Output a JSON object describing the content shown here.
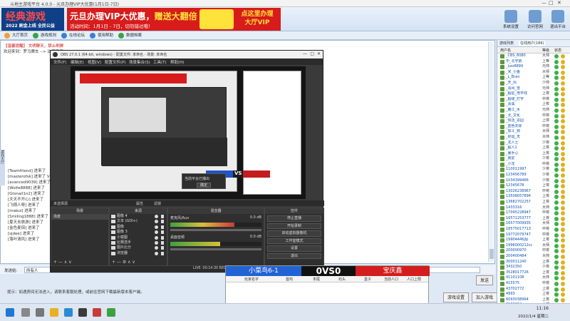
{
  "window": {
    "title": "斗地主游戏平台 4.0.0 - 元旦办理VIP大优惠(1月1日-7日)"
  },
  "logo": {
    "line1": "经典游戏",
    "line2": "2022 刷金上线 全民公益"
  },
  "ad": {
    "headline_a": "元旦办理VIP大优惠，",
    "headline_b": "赠送大翻倍",
    "sub": "活动时间：1月1日 - 7日，切勿错过哦！",
    "right_top": "点这里办理",
    "right_bottom": "大厅VIP"
  },
  "top_icons": [
    {
      "label": "系统设置",
      "icon": "gear-icon"
    },
    {
      "label": "访问官网",
      "icon": "home-icon"
    },
    {
      "label": "退出平台",
      "icon": "exit-icon"
    }
  ],
  "toolbar": {
    "items": [
      {
        "label": "大厅首页",
        "icon": "home-icon"
      },
      {
        "label": "游戏规则",
        "icon": "rules-icon"
      },
      {
        "label": "在线论坛",
        "icon": "forum-icon"
      },
      {
        "label": "使用帮助",
        "icon": "help-icon"
      },
      {
        "label": "数据档案",
        "icon": "archive-icon"
      }
    ]
  },
  "chat": {
    "lines": [
      "【温馨提醒】 文明聊天，禁止刷屏",
      "欢迎来到：罗马赛车 --> 比赛房间",
      "[Teamfriend] 进来了",
      "[masterofsk] 进来了 VIP",
      "[avanced9039] 进来了",
      "[Wolfe8888] 进来了",
      "[Gtsnail1n2] 进来了",
      "[天天不开心] 进来了",
      "[飞翔人呀] 进来了",
      "[mabui] 进来了",
      "[Smiling1888] 进来了",
      "[夏天去旅游] 进来了",
      "[金色麦田] 进来了",
      "[sjdee] 进来了",
      "[落叶清风] 进来了"
    ],
    "side_tab": "游戏大厅",
    "send_label": "发送给:",
    "send_target": "所有人",
    "send_button": "发送",
    "hint": "提示：如遇房间无法进入，请联系客服处理，或前往官网下载最新版本客户端。",
    "buttons": {
      "settings": "游戏设置",
      "join": "加入游戏"
    }
  },
  "users": {
    "tabs": [
      "游戏列表",
      "在线用户(186)"
    ],
    "headers": [
      "用户名",
      "等级",
      "状态"
    ],
    "rows": [
      {
        "name": "_CBS_8080",
        "level": "大师"
      },
      {
        "name": "中_北宇航",
        "level": "上等"
      },
      {
        "name": "_Loo8899",
        "level": "元帅"
      },
      {
        "name": "_米_小鱼",
        "level": "大师"
      },
      {
        "name": "_L_Bran",
        "level": "上等"
      },
      {
        "name": "_天_风",
        "level": "少帅"
      },
      {
        "name": "_清风_雪",
        "level": "元帅"
      },
      {
        "name": "_超星_地平线",
        "level": "上将"
      },
      {
        "name": "_超级_打字",
        "level": "中将"
      },
      {
        "name": "_清溪",
        "level": "上校"
      },
      {
        "name": "_暑江_水",
        "level": "元帅"
      },
      {
        "name": "_北_文化",
        "level": "中将"
      },
      {
        "name": "_快活_思园",
        "level": "上将"
      },
      {
        "name": "_蓝色天际",
        "level": "中将"
      },
      {
        "name": "_加斗_狗",
        "level": "大师"
      },
      {
        "name": "_好运_天",
        "level": "大帅"
      },
      {
        "name": "_龙人士",
        "level": "少将"
      },
      {
        "name": "_超人1",
        "level": "上将"
      },
      {
        "name": "_暴手心",
        "level": "上将"
      },
      {
        "name": "_我爱",
        "level": "少将"
      },
      {
        "name": "_小龙",
        "level": "中将"
      },
      {
        "name": "110011997",
        "level": "少将"
      },
      {
        "name": "123456789",
        "level": "少将"
      },
      {
        "name": "1034399466",
        "level": "少将"
      },
      {
        "name": "12345678",
        "level": "上将"
      },
      {
        "name": "13026238967",
        "level": "中将"
      },
      {
        "name": "13508057894",
        "level": "上将"
      },
      {
        "name": "13682702257",
        "level": "上将"
      },
      {
        "name": "1433316",
        "level": "大帅"
      },
      {
        "name": "17095228947",
        "level": "中将"
      },
      {
        "name": "16571253777",
        "level": "上将"
      },
      {
        "name": "16577009935",
        "level": "大师"
      },
      {
        "name": "18575017713",
        "level": "中将"
      },
      {
        "name": "19772079747",
        "level": "中将"
      },
      {
        "name": "19904446jlp",
        "level": "上将"
      },
      {
        "name": "1996000212cc",
        "level": "大师"
      },
      {
        "name": "200000970",
        "level": "中将"
      },
      {
        "name": "200400484",
        "level": "大帅"
      },
      {
        "name": "300011240",
        "level": "上将"
      },
      {
        "name": "3432350",
        "level": "少将"
      },
      {
        "name": "3528017726",
        "level": "上将"
      },
      {
        "name": "41101108",
        "level": "大帅"
      },
      {
        "name": "415575",
        "level": "中将"
      },
      {
        "name": "43702772",
        "level": "上将"
      },
      {
        "name": "4993",
        "level": "上将"
      },
      {
        "name": "6093038964",
        "level": "上将"
      },
      {
        "name": "6192804",
        "level": "大帅"
      },
      {
        "name": "6033470",
        "level": "少将"
      },
      {
        "name": "64520023",
        "level": "大帅"
      },
      {
        "name": "AP超1_球",
        "level": "中将"
      },
      {
        "name": "Adam_nagar",
        "level": "上将"
      }
    ]
  },
  "obs": {
    "title": "OBS 27.0.1 (64-bit, windows) - 配置文件: 未命名 - 场景: 未命名",
    "menu": [
      "文件(F)",
      "编辑(E)",
      "视图(V)",
      "配置文件(P)",
      "场景集合(S)",
      "工具(T)",
      "帮助(H)"
    ],
    "popup_line": "当前平台已播出",
    "popup_button": "确定",
    "scene_label": "未选择源",
    "props_btn": "属性",
    "filter_btn": "滤镜",
    "docks": {
      "scenes": "场景",
      "sources": "来源",
      "mixer": "混音器",
      "controls": "控件"
    },
    "scene_items": [
      "场景"
    ],
    "sources": [
      "图像 4",
      "文本 (GDI+)",
      "图像",
      "图像 3",
      "小镜图",
      "比赛选手",
      "图片比分",
      "浏览器"
    ],
    "mixer": [
      {
        "name": "麦克风/Aux",
        "db": "0.0 dB"
      },
      {
        "name": "桌面音频",
        "db": "0.0 dB"
      }
    ],
    "controls": [
      "停止直播",
      "开始录制",
      "启动虚拟摄像机",
      "工作室模式",
      "设置",
      "退出"
    ],
    "controls_tabs": [
      "控件",
      "场景切换"
    ],
    "status": "LIVE: 00:14:30   REC: 00:00:00   CPU: 3.2%, 30.00 fps"
  },
  "scoreboard": {
    "team_blue": "小菜鸟6-1",
    "score": "0VS0",
    "team_red": "宝庆鑫",
    "columns": [
      "玩家名字",
      "首鸡",
      "末尾",
      "石头",
      "盒子",
      "当前人口",
      "人口上限"
    ]
  },
  "taskbar": {
    "time": "11:16",
    "date": "2022/1/4 星期二"
  }
}
